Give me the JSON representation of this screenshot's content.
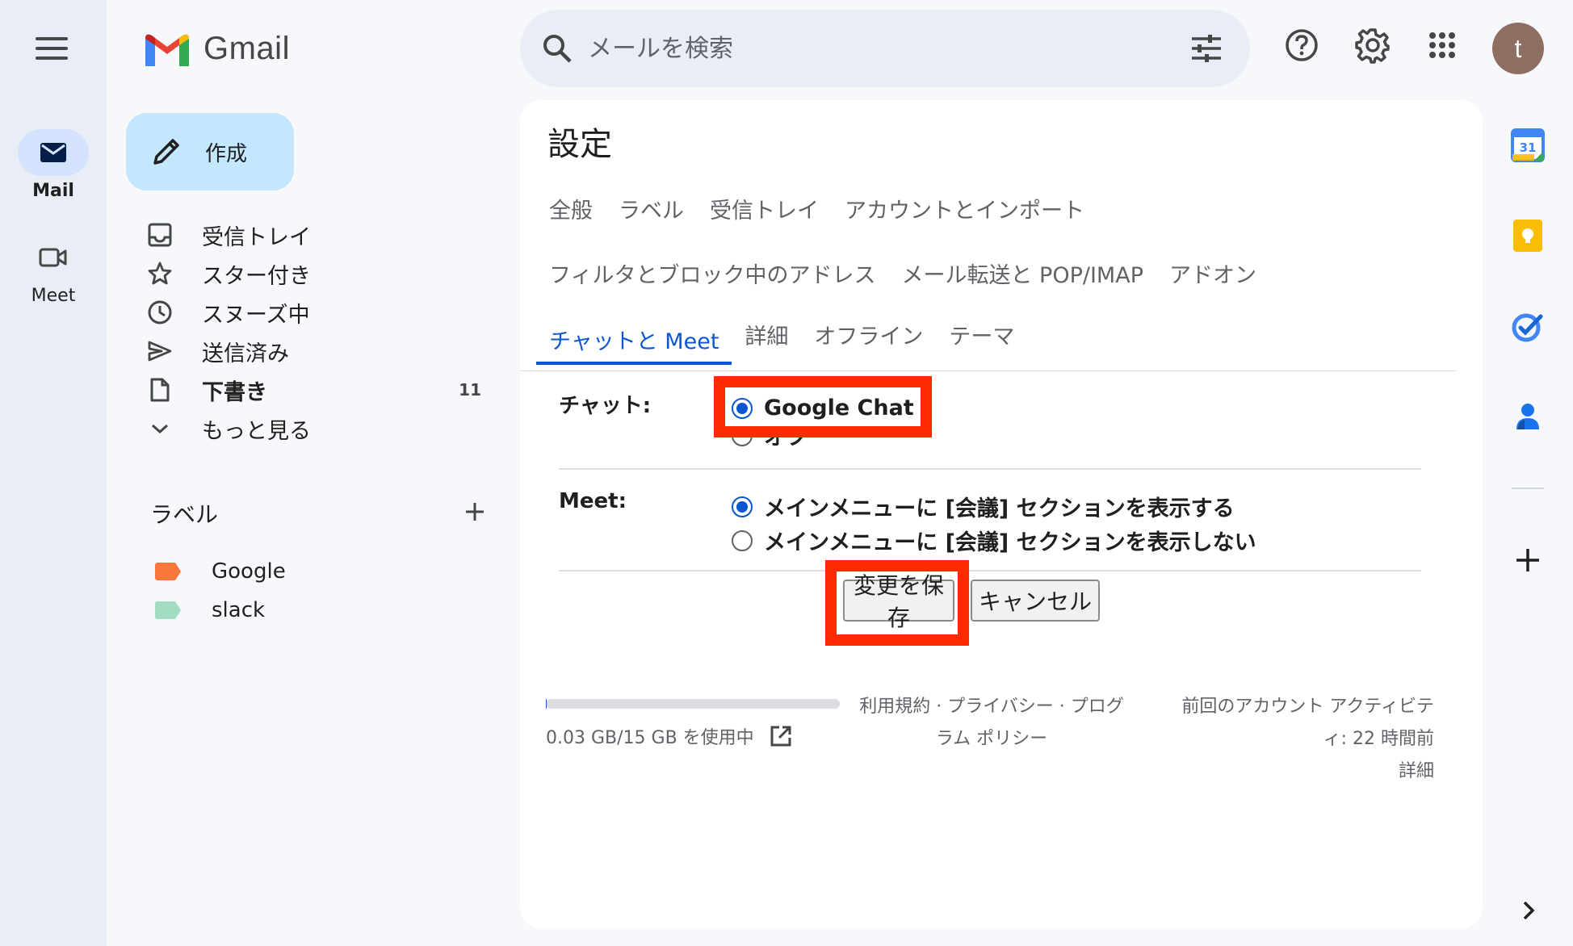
{
  "rail": {
    "mail_label": "Mail",
    "meet_label": "Meet"
  },
  "app": {
    "name": "Gmail"
  },
  "compose": {
    "label": "作成"
  },
  "nav": {
    "items": [
      {
        "label": "受信トレイ",
        "icon": "inbox-icon"
      },
      {
        "label": "スター付き",
        "icon": "star-icon"
      },
      {
        "label": "スヌーズ中",
        "icon": "clock-icon"
      },
      {
        "label": "送信済み",
        "icon": "send-icon"
      },
      {
        "label": "下書き",
        "icon": "draft-icon",
        "count": "11"
      },
      {
        "label": "もっと見る",
        "icon": "chevron-down-icon"
      }
    ]
  },
  "labels": {
    "title": "ラベル",
    "items": [
      {
        "name": "Google",
        "color": "#f9763c"
      },
      {
        "name": "slack",
        "color": "#a2dcc1"
      }
    ]
  },
  "search": {
    "placeholder": "メールを検索"
  },
  "settings": {
    "title": "設定",
    "tabs_row1": [
      "全般",
      "ラベル",
      "受信トレイ",
      "アカウントとインポート"
    ],
    "tabs_row2": [
      "フィルタとブロック中のアドレス",
      "メール転送と POP/IMAP",
      "アドオン"
    ],
    "tabs_row3": [
      "チャットと Meet",
      "詳細",
      "オフライン",
      "テーマ"
    ],
    "active_tab": "チャットと Meet",
    "chat": {
      "label": "チャット:",
      "options": [
        "Google Chat",
        "オフ"
      ],
      "selected": "Google Chat"
    },
    "meet": {
      "label": "Meet:",
      "options": [
        "メインメニューに [会議] セクションを表示する",
        "メインメニューに [会議] セクションを表示しない"
      ],
      "selected": "メインメニューに [会議] セクションを表示する"
    },
    "save_button": "変更を保存",
    "cancel_button": "キャンセル"
  },
  "footer": {
    "usage": "0.03 GB/15 GB を使用中",
    "usage_fraction": 0.002,
    "policy_line1": "利用規約 · プライバシー · プログ",
    "policy_line2": "ラム ポリシー",
    "activity_line1": "前回のアカウント アクティビテ",
    "activity_line2": "ィ: 22 時間前",
    "details": "詳細"
  },
  "colors": {
    "accent": "#0b57d0",
    "highlight": "#ff2a00",
    "compose_bg": "#c2e7ff"
  }
}
